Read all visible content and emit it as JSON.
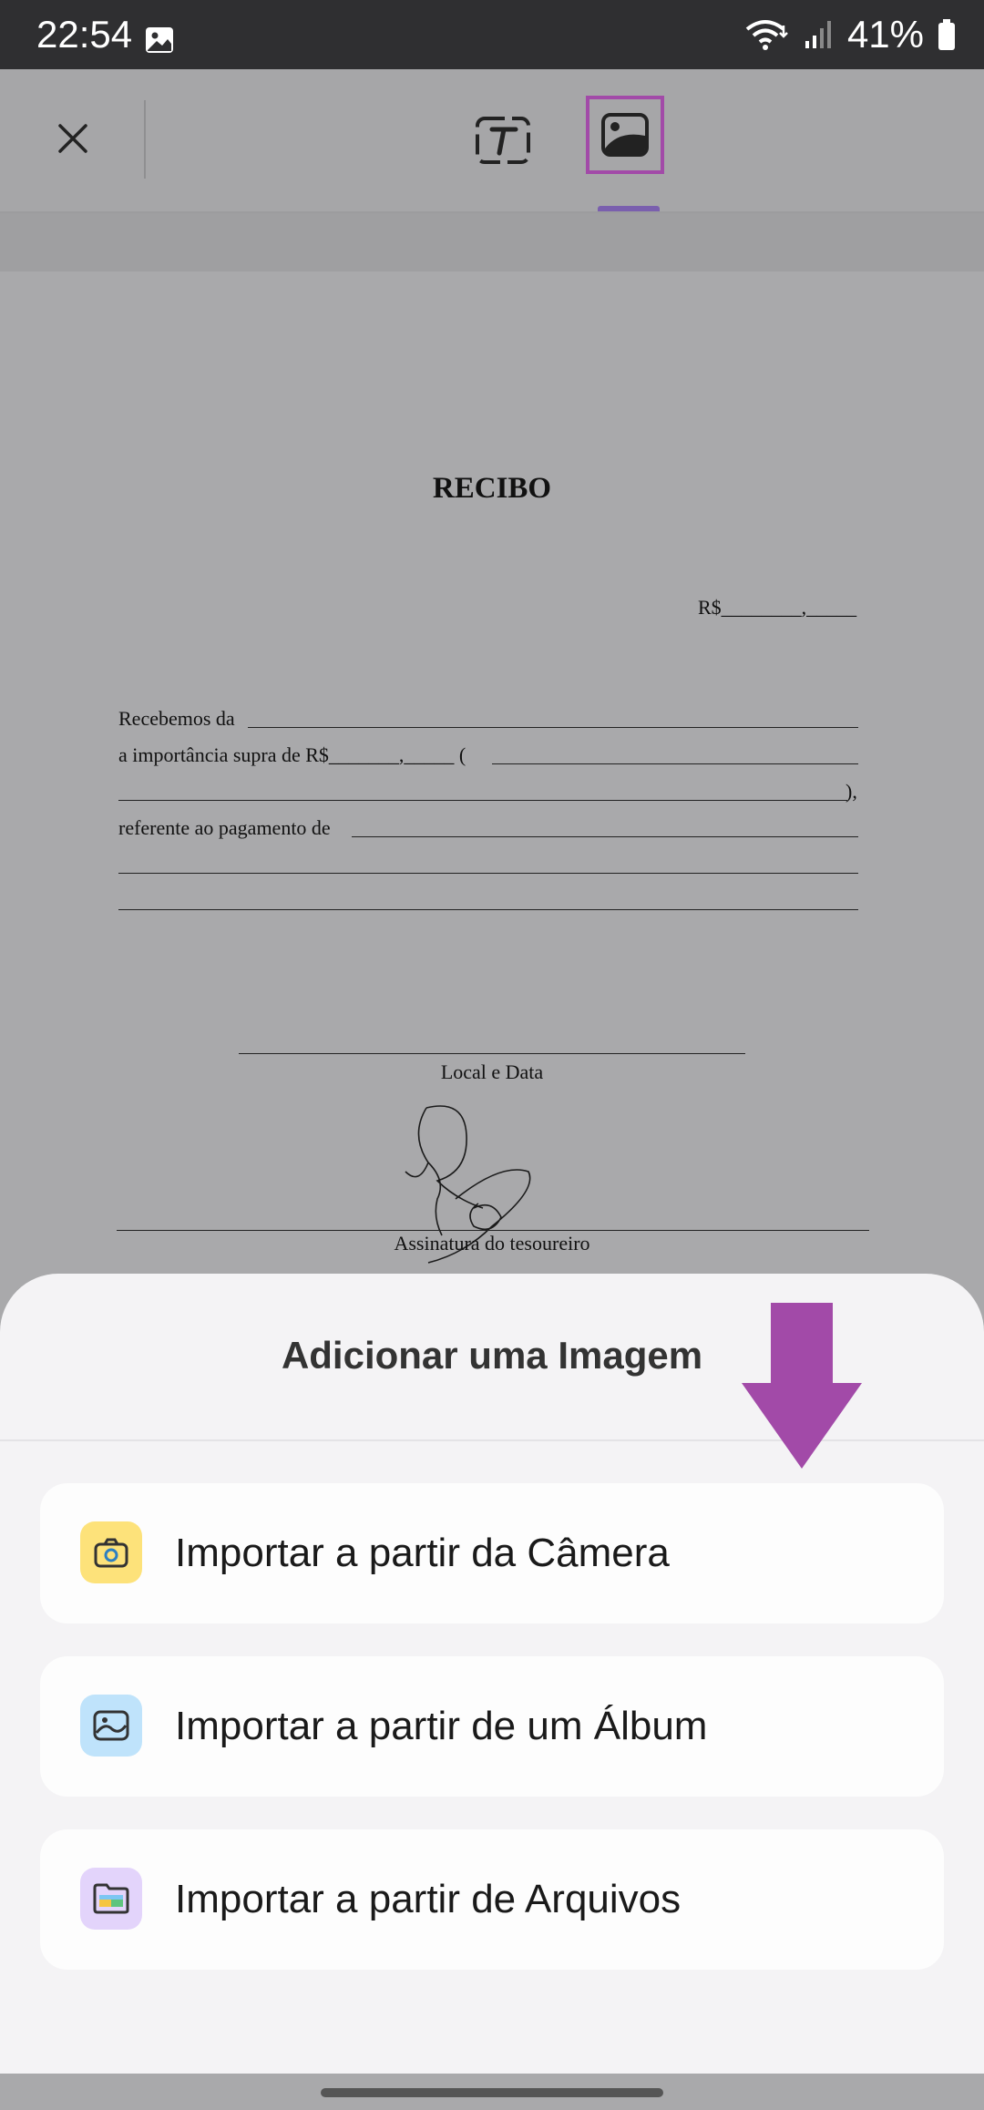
{
  "status": {
    "time": "22:54",
    "battery": "41%",
    "icons": [
      "image-icon",
      "wifi-icon",
      "signal-icon",
      "battery-icon"
    ]
  },
  "toolbar": {
    "icons": [
      "close-icon",
      "text-tool-icon",
      "image-tool-icon"
    ],
    "highlight_color": "#a24aa8"
  },
  "document": {
    "title": "RECIBO",
    "amount": "R$________,_____",
    "line1": "Recebemos da",
    "line2": "a importância supra de R$_______,_____ (",
    "line3_end": "),",
    "line4": "referente ao pagamento de",
    "caption_local": "Local e Data",
    "caption_signature": "Assinatura do tesoureiro"
  },
  "sheet": {
    "title": "Adicionar uma Imagem",
    "options": [
      {
        "label": "Importar a partir da Câmera",
        "icon": "camera-icon",
        "color": "#fde27a"
      },
      {
        "label": "Importar a partir de um Álbum",
        "icon": "album-icon",
        "color": "#bfe3fb"
      },
      {
        "label": "Importar a partir de Arquivos",
        "icon": "folder-icon",
        "color": "#e3d4fb"
      }
    ]
  },
  "annotation": {
    "arrow_color": "#a24aa8"
  }
}
